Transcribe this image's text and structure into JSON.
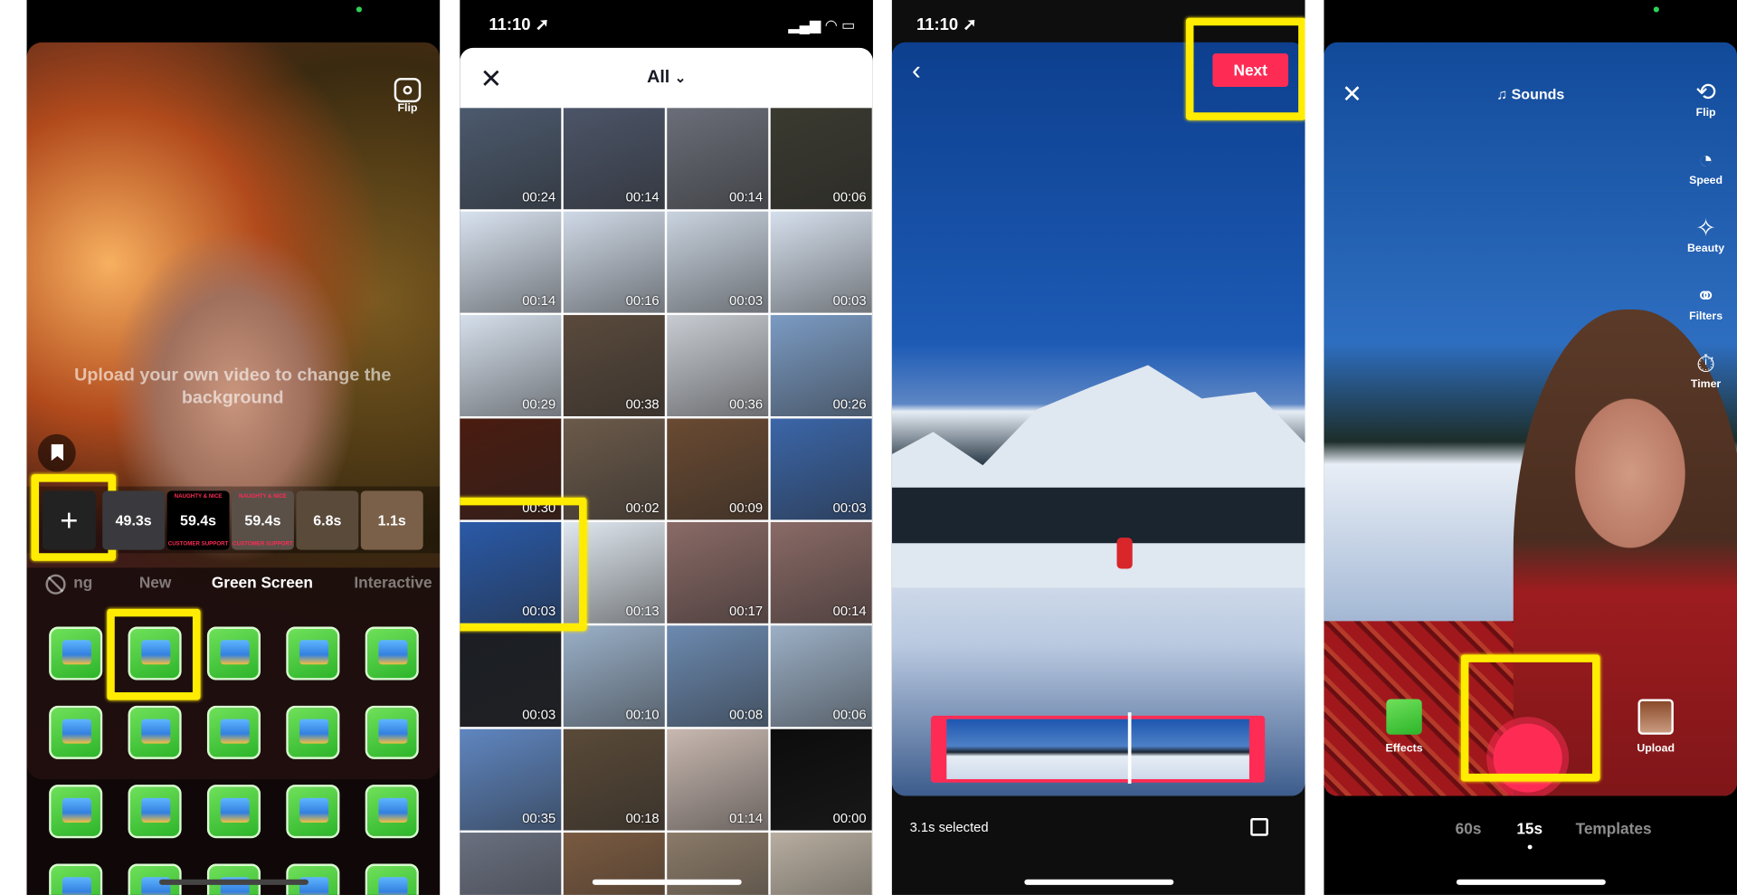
{
  "colors": {
    "accent": "#fe2c55",
    "highlight": "#ffec00",
    "effect_green": "#2db52a"
  },
  "panel1": {
    "flip_label": "Flip",
    "hint": "Upload your own video to change the background",
    "add_button": "+",
    "clips": [
      {
        "duration": "49.3s",
        "top": "",
        "bottom": ""
      },
      {
        "duration": "59.4s",
        "top": "NAUGHTY & NICE",
        "bottom": "CUSTOMER SUPPORT"
      },
      {
        "duration": "59.4s",
        "top": "NAUGHTY & NICE",
        "bottom": "CUSTOMER SUPPORT"
      },
      {
        "duration": "6.8s",
        "top": "",
        "bottom": ""
      },
      {
        "duration": "1.1s",
        "top": "",
        "bottom": ""
      }
    ],
    "tabs": [
      "ng",
      "New",
      "Green Screen",
      "Interactive"
    ],
    "active_tab": "Green Screen",
    "effect_rows": 4,
    "effect_cols": 5
  },
  "panel2": {
    "time": "11:10",
    "album": "All",
    "durations": [
      "00:24",
      "00:14",
      "00:14",
      "00:06",
      "00:14",
      "00:16",
      "00:03",
      "00:03",
      "00:29",
      "00:38",
      "00:36",
      "00:26",
      "00:30",
      "00:02",
      "00:09",
      "00:03",
      "00:03",
      "00:13",
      "00:17",
      "00:14",
      "00:03",
      "00:10",
      "00:08",
      "00:06",
      "00:35",
      "00:18",
      "01:14",
      "00:00",
      "",
      "",
      "",
      ""
    ],
    "cell_colors": [
      "#4c5a6e",
      "#4c5568",
      "#6a6e78",
      "#3b3a30",
      "#d8e2ef",
      "#cfd9e6",
      "#c9d3df",
      "#d5dfec",
      "#d5dfeb",
      "#5a4a3c",
      "#c8ccd2",
      "#7b9bc3",
      "#4a1c10",
      "#6b5a4a",
      "#6a4a32",
      "#3b66a8",
      "#2a5aa8",
      "#dfe7ef",
      "#8a6a66",
      "#8a6a66",
      "#1b1e24",
      "#9ab0c8",
      "#6c8ab0",
      "#9cb0c6",
      "#5f86c0",
      "#5a4a38",
      "#c8b8b0",
      "#0c0c0c",
      "#6a7080",
      "#7a5a40",
      "#8a7a68",
      "#b8aea0"
    ]
  },
  "panel3": {
    "time": "11:10",
    "next_label": "Next",
    "selected": "3.1s selected",
    "playhead_fraction": 0.6
  },
  "panel4": {
    "sounds_label": "Sounds",
    "tools": [
      "Flip",
      "Speed",
      "Beauty",
      "Filters",
      "Timer"
    ],
    "effects_label": "Effects",
    "upload_label": "Upload",
    "modes": [
      "60s",
      "15s",
      "Templates"
    ],
    "active_mode": "15s"
  }
}
